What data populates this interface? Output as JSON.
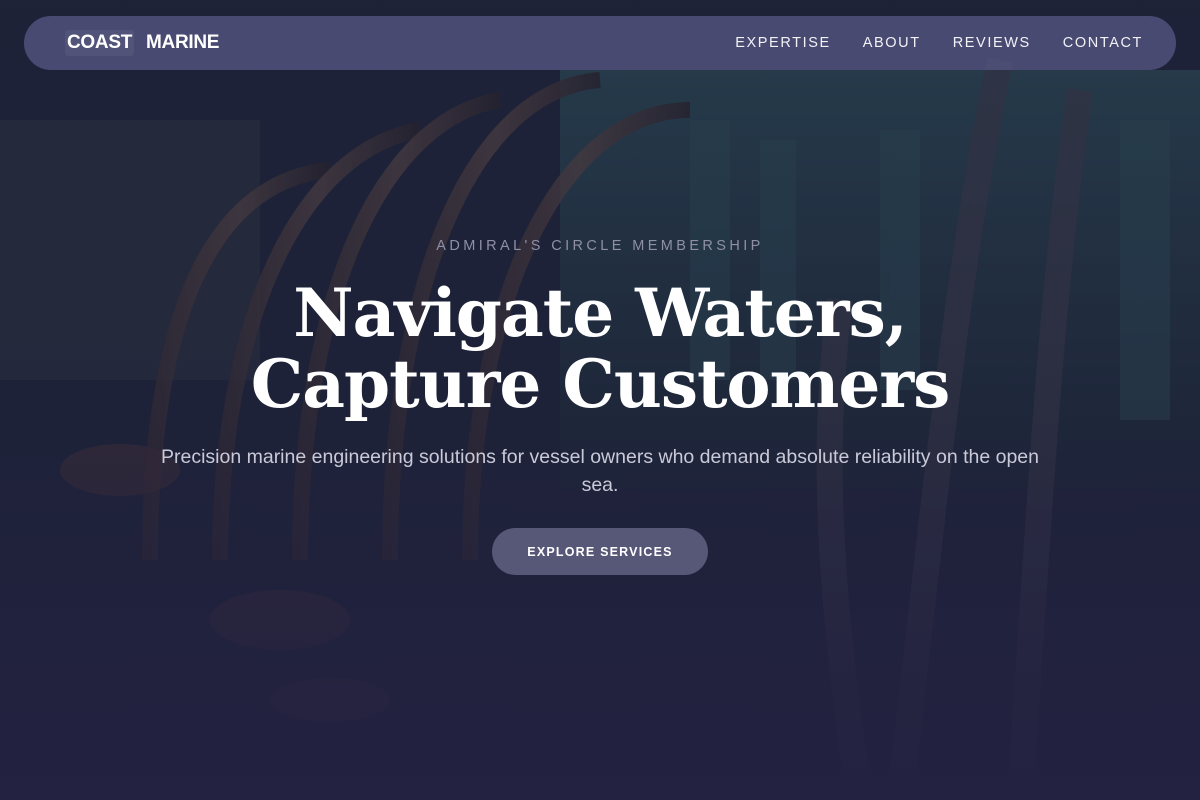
{
  "brand": {
    "word1": "COAST",
    "word2": "MARINE"
  },
  "nav": {
    "links": [
      {
        "label": "EXPERTISE"
      },
      {
        "label": "ABOUT"
      },
      {
        "label": "REVIEWS"
      },
      {
        "label": "CONTACT"
      }
    ]
  },
  "hero": {
    "eyebrow": "ADMIRAL'S CIRCLE MEMBERSHIP",
    "headline_line1": "Navigate Waters,",
    "headline_line2": "Capture Customers",
    "subtitle": "Precision marine engineering solutions for vessel owners who demand absolute reliability on the open sea.",
    "cta_label": "EXPLORE SERVICES"
  },
  "colors": {
    "background": "#222140",
    "nav_bar": "#565682",
    "cta": "#575878",
    "eyebrow": "#8f8fa8"
  }
}
